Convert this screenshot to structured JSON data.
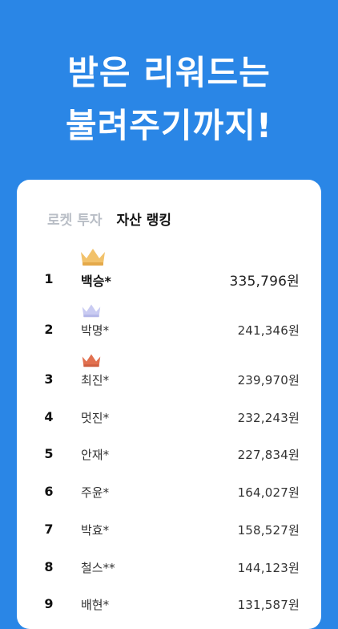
{
  "headline": {
    "line1": "받은 리워드는",
    "line2": "불려주기까지!"
  },
  "tabs": {
    "rocket": "로켓 투자",
    "asset": "자산 랭킹"
  },
  "colors": {
    "background": "#2a86e6",
    "gold": "#f2c26b",
    "silver": "#c9cbf2",
    "bronze": "#e1704f"
  },
  "ranking": [
    {
      "rank": "1",
      "name": "백승*",
      "amount": "335,796원",
      "crown": "gold-crown-icon"
    },
    {
      "rank": "2",
      "name": "박명*",
      "amount": "241,346원",
      "crown": "silver-crown-icon"
    },
    {
      "rank": "3",
      "name": "최진*",
      "amount": "239,970원",
      "crown": "bronze-crown-icon"
    },
    {
      "rank": "4",
      "name": "멋진*",
      "amount": "232,243원"
    },
    {
      "rank": "5",
      "name": "안재*",
      "amount": "227,834원"
    },
    {
      "rank": "6",
      "name": "주윤*",
      "amount": "164,027원"
    },
    {
      "rank": "7",
      "name": "박효*",
      "amount": "158,527원"
    },
    {
      "rank": "8",
      "name": "철스**",
      "amount": "144,123원"
    },
    {
      "rank": "9",
      "name": "배현*",
      "amount": "131,587원"
    }
  ]
}
